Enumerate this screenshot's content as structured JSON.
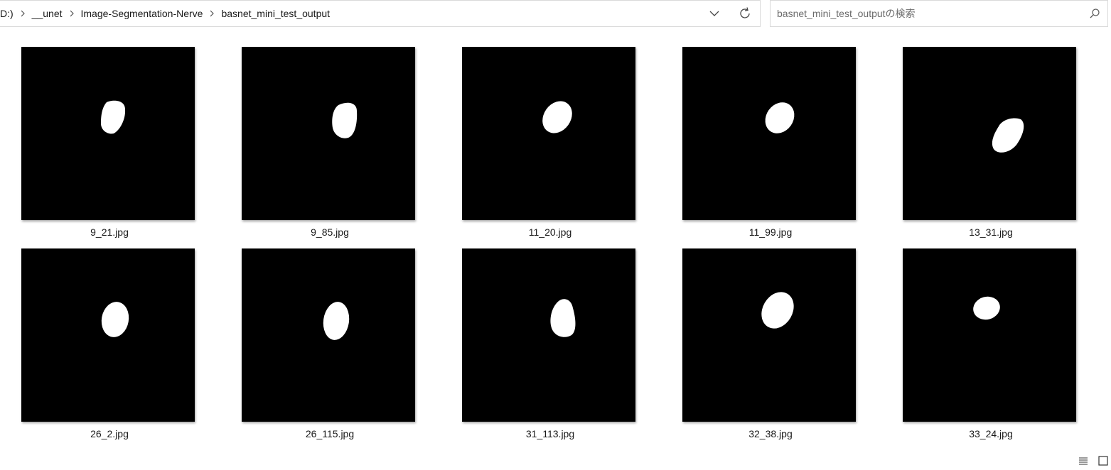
{
  "address_bar": {
    "breadcrumbs": [
      {
        "label": "D:)"
      },
      {
        "label": "__unet"
      },
      {
        "label": "Image-Segmentation-Nerve"
      },
      {
        "label": "basnet_mini_test_output"
      }
    ],
    "dropdown_icon": "chevron-down-icon",
    "refresh_icon": "refresh-icon"
  },
  "search": {
    "placeholder": "basnet_mini_test_outputの検索",
    "icon": "search-icon"
  },
  "files": [
    {
      "name": "9_21.jpg"
    },
    {
      "name": "9_85.jpg"
    },
    {
      "name": "11_20.jpg"
    },
    {
      "name": "11_99.jpg"
    },
    {
      "name": "13_31.jpg"
    },
    {
      "name": "26_2.jpg"
    },
    {
      "name": "26_115.jpg"
    },
    {
      "name": "31_113.jpg"
    },
    {
      "name": "32_38.jpg"
    },
    {
      "name": "33_24.jpg"
    }
  ],
  "view_buttons": {
    "details_icon": "details-view-icon",
    "tiles_icon": "large-icons-view-icon"
  },
  "colors": {
    "thumbnail_background": "#000000",
    "mask_foreground": "#ffffff",
    "border": "#d9d9d9"
  }
}
